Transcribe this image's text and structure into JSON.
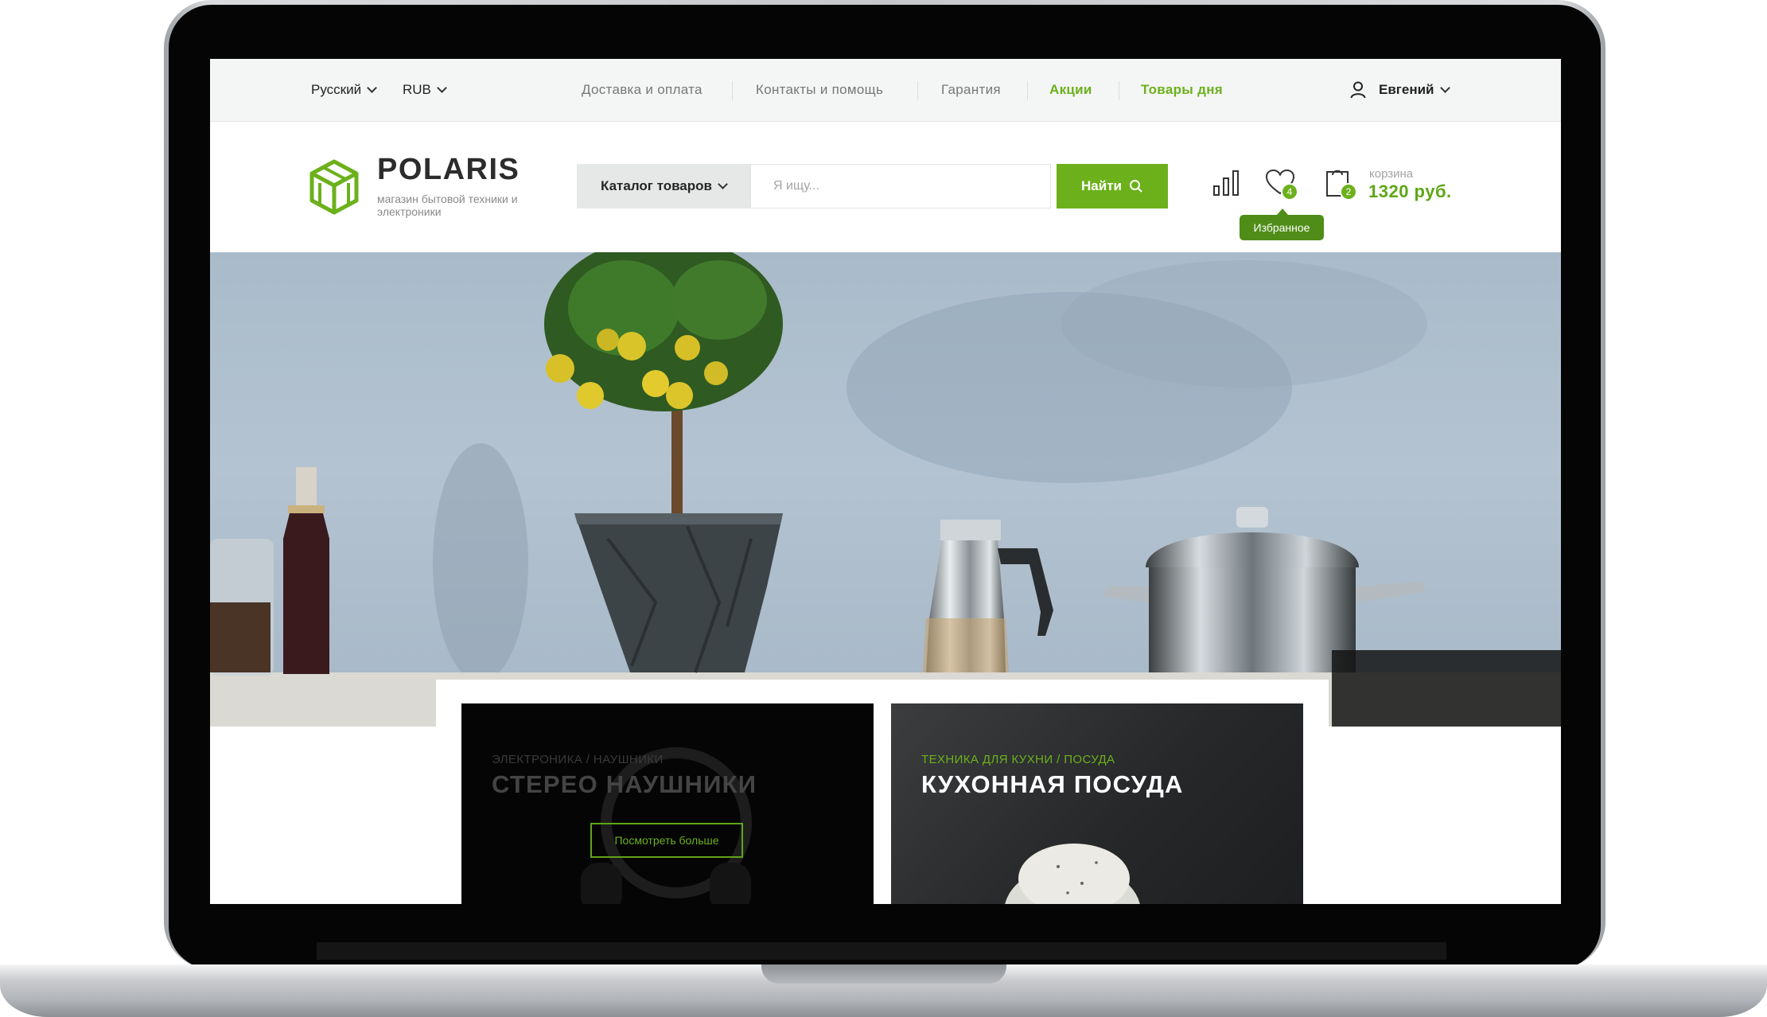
{
  "topbar": {
    "language": "Русский",
    "currency": "RUB",
    "nav": [
      "Доставка и оплата",
      "Контакты и помощь",
      "Гарантия",
      "Акции",
      "Товары дня"
    ],
    "user": "Евгений"
  },
  "header": {
    "brand": "POLARIS",
    "tagline": "магазин бытовой техники и электроники",
    "catalog_label": "Каталог товаров",
    "search_placeholder": "Я ищу...",
    "search_button": "Найти",
    "favorites_count": "4",
    "favorites_tooltip": "Избранное",
    "cart_count": "2",
    "cart_label": "корзина",
    "cart_total": "1320 руб."
  },
  "promos": [
    {
      "category": "ЭЛЕКТРОНИКА / НАУШНИКИ",
      "title": "СТЕРЕО НАУШНИКИ",
      "button": "Посмотреть больше"
    },
    {
      "category": "ТЕХНИКА ДЛЯ КУХНИ / ПОСУДА",
      "title": "КУХОННАЯ ПОСУДА"
    }
  ],
  "colors": {
    "accent": "#6cb11c",
    "accent_dark": "#4f8d18"
  }
}
